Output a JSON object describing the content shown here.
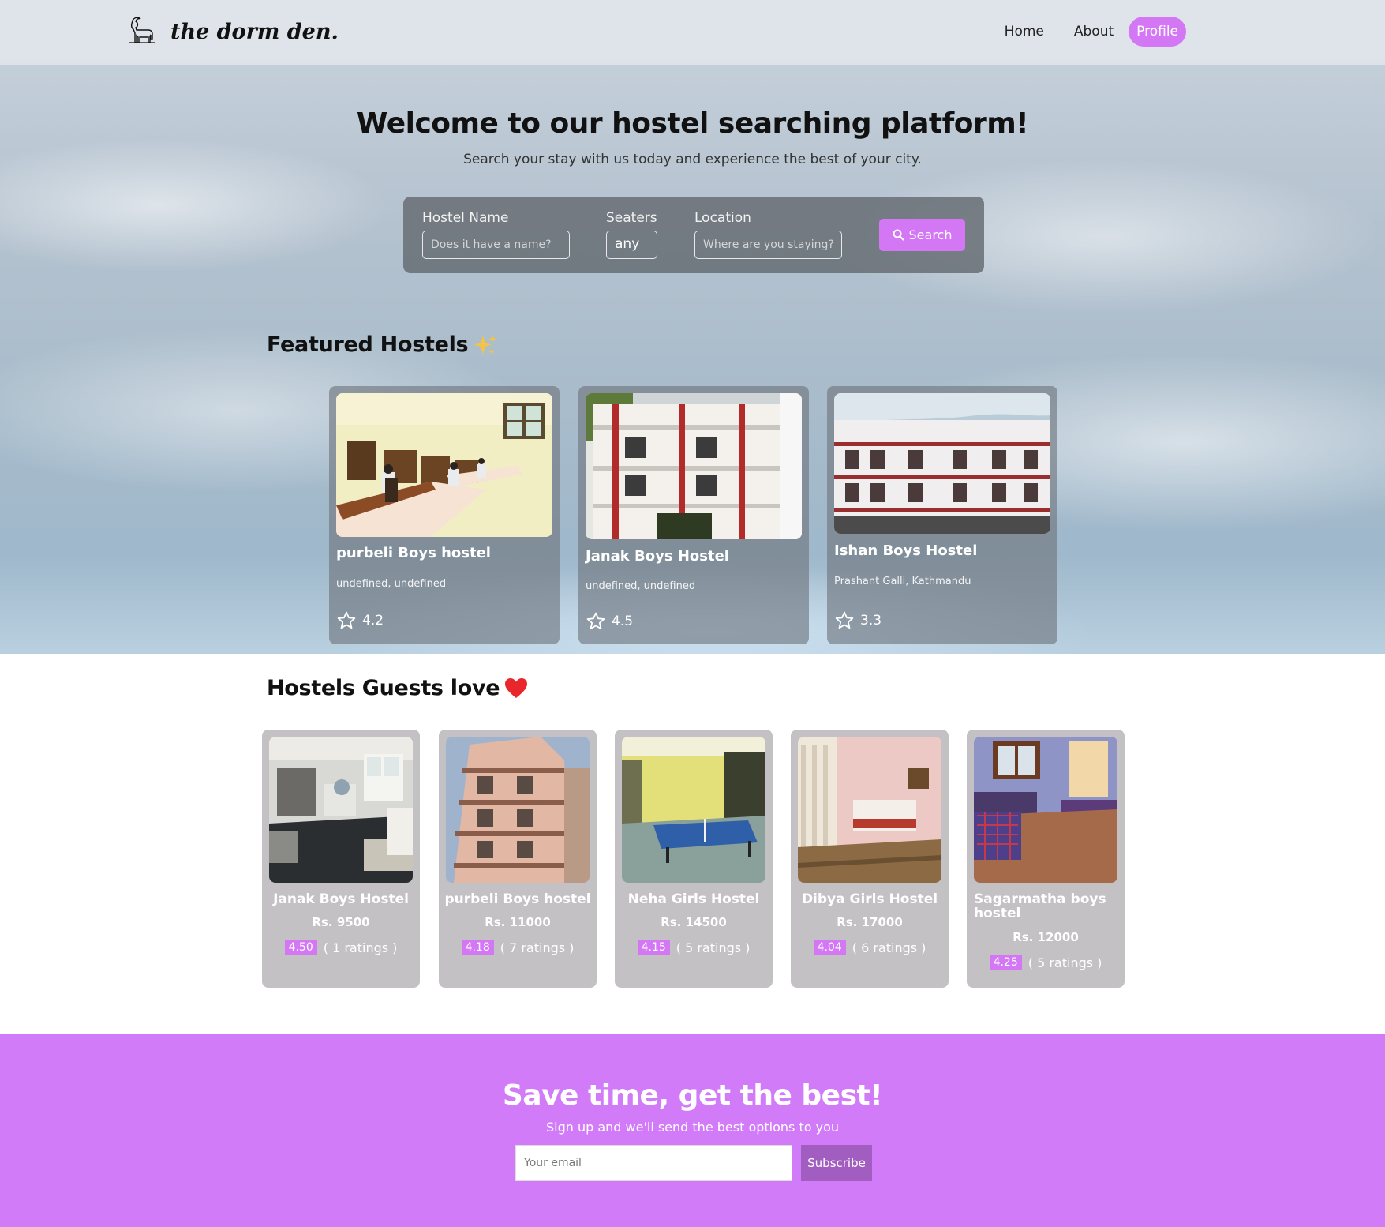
{
  "brand": {
    "name": "the dorm den.",
    "logo_icon": "goat-icon"
  },
  "nav": {
    "home": "Home",
    "about": "About",
    "profile": "Profile"
  },
  "hero": {
    "title": "Welcome to our hostel searching platform!",
    "subtitle": "Search your stay with us today and experience the best of your city."
  },
  "search": {
    "name_label": "Hostel Name",
    "name_placeholder": "Does it have a name?",
    "seaters_label": "Seaters",
    "seaters_value": "any",
    "location_label": "Location",
    "location_placeholder": "Where are you staying?",
    "button": "Search",
    "button_icon": "search-icon"
  },
  "featured": {
    "title": "Featured Hostels",
    "title_icon": "sparkles-icon",
    "items": [
      {
        "name": "purbeli Boys hostel",
        "location": "undefined, undefined",
        "rating": "4.2"
      },
      {
        "name": "Janak Boys Hostel",
        "location": "undefined, undefined",
        "rating": "4.5"
      },
      {
        "name": "Ishan Boys Hostel",
        "location": "Prashant Galli, Kathmandu",
        "rating": "3.3"
      }
    ]
  },
  "guests_love": {
    "title": "Hostels Guests love",
    "title_icon": "heart-icon",
    "items": [
      {
        "name": "Janak Boys Hostel",
        "price": "Rs. 9500",
        "rating": "4.50",
        "ratings_text": "( 1 ratings )"
      },
      {
        "name": "purbeli Boys hostel",
        "price": "Rs. 11000",
        "rating": "4.18",
        "ratings_text": "( 7 ratings )"
      },
      {
        "name": "Neha Girls Hostel",
        "price": "Rs. 14500",
        "rating": "4.15",
        "ratings_text": "( 5 ratings )"
      },
      {
        "name": "Dibya Girls Hostel",
        "price": "Rs. 17000",
        "rating": "4.04",
        "ratings_text": "( 6 ratings )"
      },
      {
        "name": "Sagarmatha boys hostel",
        "price": "Rs. 12000",
        "rating": "4.25",
        "ratings_text": "( 5 ratings )"
      }
    ]
  },
  "subscribe": {
    "title": "Save time, get the best!",
    "text": "Sign up and we'll send the best options to you",
    "email_placeholder": "Your email",
    "button": "Subscribe"
  },
  "colors": {
    "accent": "#d477f5",
    "subscribe_bg": "#d27bf8",
    "subscribe_button": "#a15dbf",
    "heart": "#e8262b"
  }
}
